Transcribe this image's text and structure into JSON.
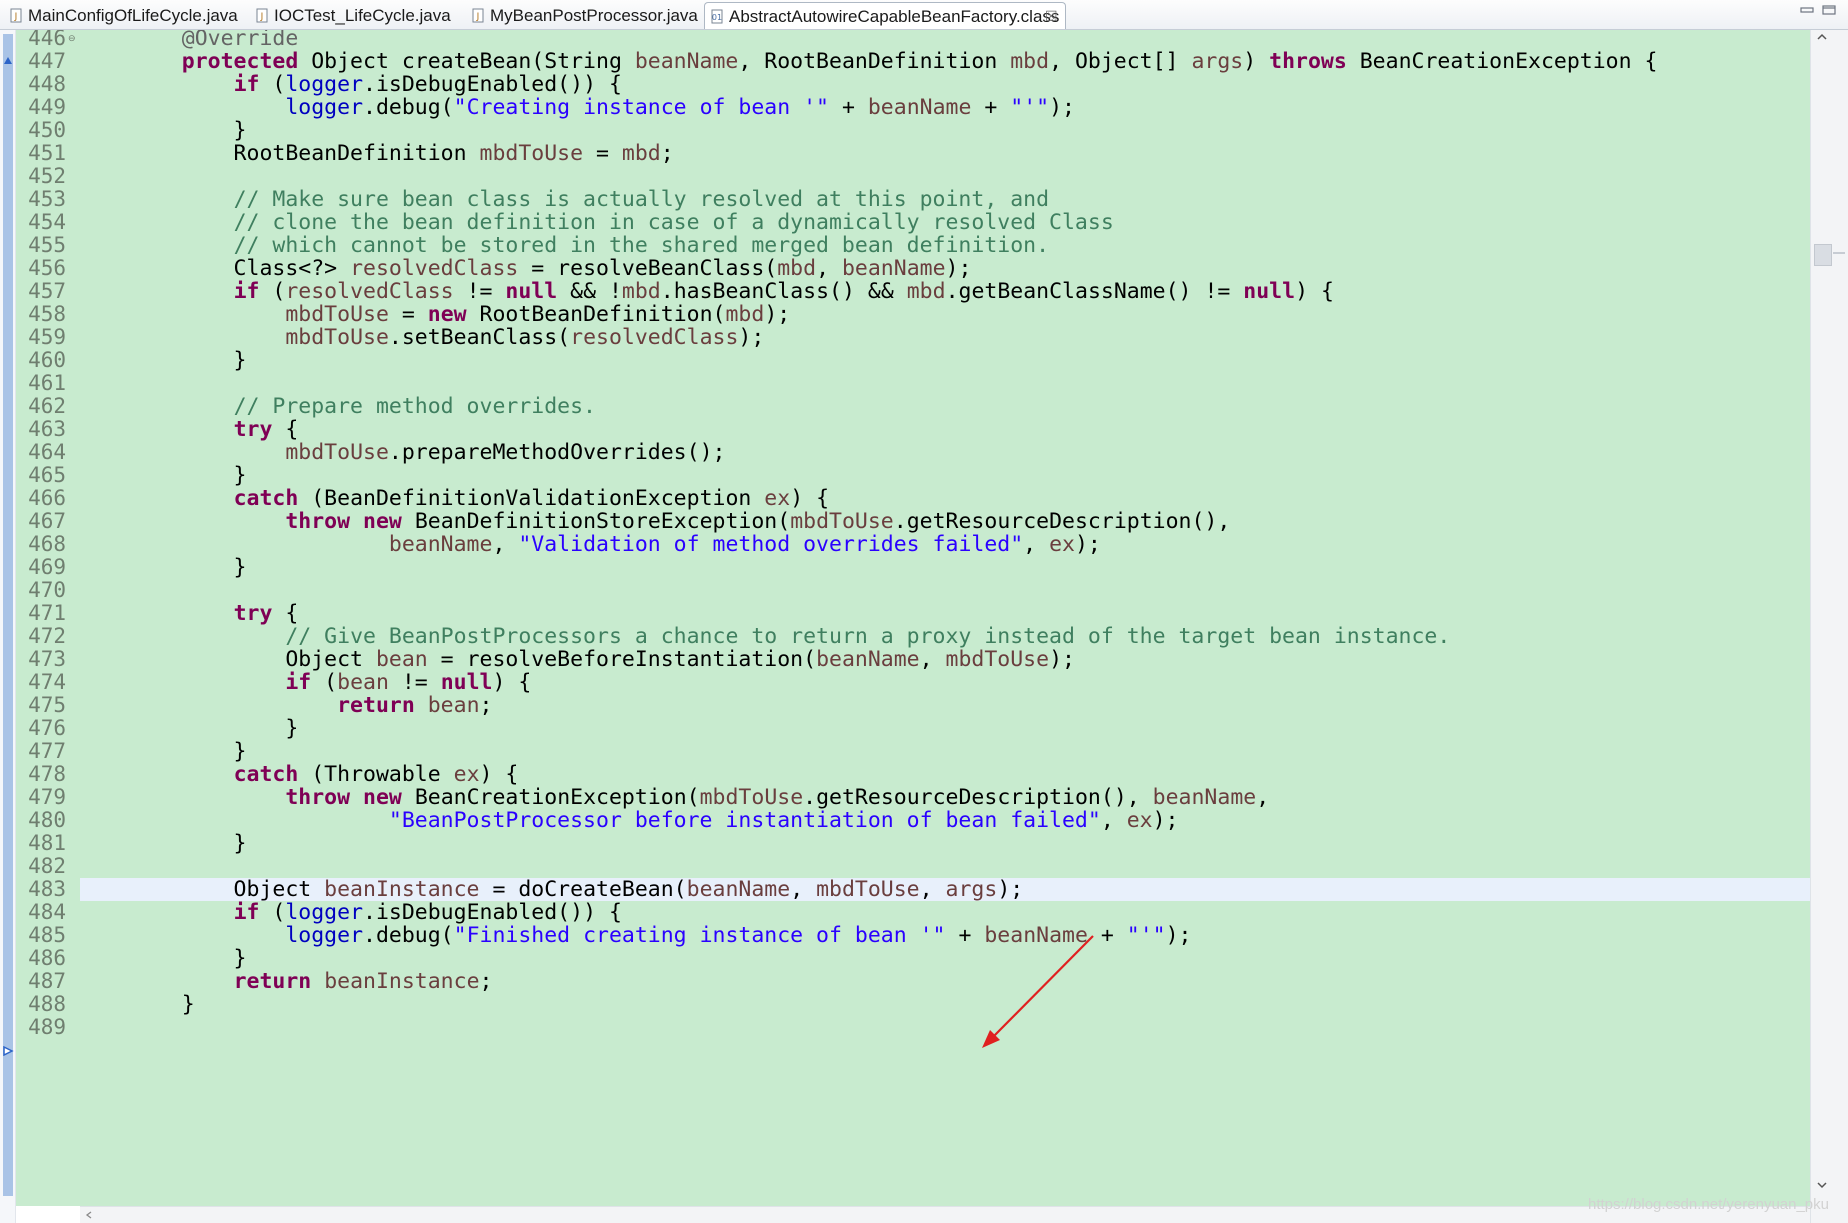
{
  "tabs": [
    {
      "label": "MainConfigOfLifeCycle.java",
      "icon": "java-file-icon",
      "active": false
    },
    {
      "label": "IOCTest_LifeCycle.java",
      "icon": "java-file-icon",
      "active": false
    },
    {
      "label": "MyBeanPostProcessor.java",
      "icon": "java-file-icon",
      "active": false
    },
    {
      "label": "AbstractAutowireCapableBeanFactory.class",
      "icon": "class-file-icon",
      "active": true
    }
  ],
  "tab_close_glyph": "☒",
  "editor": {
    "current_line": 483,
    "lines": [
      {
        "num": "446",
        "tokens": [
          [
            "    ",
            ""
          ],
          [
            "@Override",
            "ann"
          ]
        ]
      },
      {
        "num": "447",
        "tokens": [
          [
            "    ",
            ""
          ],
          [
            "protected",
            "kw"
          ],
          [
            " Object createBean(String ",
            ""
          ],
          [
            "beanName",
            "var"
          ],
          [
            ", RootBeanDefinition ",
            ""
          ],
          [
            "mbd",
            "var"
          ],
          [
            ", Object[] ",
            ""
          ],
          [
            "args",
            "var"
          ],
          [
            ") ",
            ""
          ],
          [
            "throws",
            "kw"
          ],
          [
            " BeanCreationException {",
            ""
          ]
        ]
      },
      {
        "num": "448",
        "tokens": [
          [
            "        ",
            ""
          ],
          [
            "if",
            "kw"
          ],
          [
            " (",
            ""
          ],
          [
            "logger",
            "fld"
          ],
          [
            ".isDebugEnabled()) {",
            ""
          ]
        ]
      },
      {
        "num": "449",
        "tokens": [
          [
            "            ",
            ""
          ],
          [
            "logger",
            "fld"
          ],
          [
            ".debug(",
            ""
          ],
          [
            "\"Creating instance of bean '\"",
            "str"
          ],
          [
            " + ",
            ""
          ],
          [
            "beanName",
            "var"
          ],
          [
            " + ",
            ""
          ],
          [
            "\"'\"",
            "str"
          ],
          [
            ");",
            ""
          ]
        ]
      },
      {
        "num": "450",
        "tokens": [
          [
            "        }",
            ""
          ]
        ]
      },
      {
        "num": "451",
        "tokens": [
          [
            "        RootBeanDefinition ",
            ""
          ],
          [
            "mbdToUse",
            "var"
          ],
          [
            " = ",
            ""
          ],
          [
            "mbd",
            "var"
          ],
          [
            ";",
            ""
          ]
        ]
      },
      {
        "num": "452",
        "tokens": []
      },
      {
        "num": "453",
        "tokens": [
          [
            "        ",
            ""
          ],
          [
            "// Make sure bean class is actually resolved at this point, and",
            "com"
          ]
        ]
      },
      {
        "num": "454",
        "tokens": [
          [
            "        ",
            ""
          ],
          [
            "// clone the bean definition in case of a dynamically resolved Class",
            "com"
          ]
        ]
      },
      {
        "num": "455",
        "tokens": [
          [
            "        ",
            ""
          ],
          [
            "// which cannot be stored in the shared merged bean definition.",
            "com"
          ]
        ]
      },
      {
        "num": "456",
        "tokens": [
          [
            "        Class<?> ",
            ""
          ],
          [
            "resolvedClass",
            "var"
          ],
          [
            " = resolveBeanClass(",
            ""
          ],
          [
            "mbd",
            "var"
          ],
          [
            ", ",
            ""
          ],
          [
            "beanName",
            "var"
          ],
          [
            ");",
            ""
          ]
        ]
      },
      {
        "num": "457",
        "tokens": [
          [
            "        ",
            ""
          ],
          [
            "if",
            "kw"
          ],
          [
            " (",
            ""
          ],
          [
            "resolvedClass",
            "var"
          ],
          [
            " != ",
            ""
          ],
          [
            "null",
            "kw"
          ],
          [
            " && !",
            ""
          ],
          [
            "mbd",
            "var"
          ],
          [
            ".hasBeanClass() && ",
            ""
          ],
          [
            "mbd",
            "var"
          ],
          [
            ".getBeanClassName() != ",
            ""
          ],
          [
            "null",
            "kw"
          ],
          [
            ") {",
            ""
          ]
        ]
      },
      {
        "num": "458",
        "tokens": [
          [
            "            ",
            ""
          ],
          [
            "mbdToUse",
            "var"
          ],
          [
            " = ",
            ""
          ],
          [
            "new",
            "kw"
          ],
          [
            " RootBeanDefinition(",
            ""
          ],
          [
            "mbd",
            "var"
          ],
          [
            ");",
            ""
          ]
        ]
      },
      {
        "num": "459",
        "tokens": [
          [
            "            ",
            ""
          ],
          [
            "mbdToUse",
            "var"
          ],
          [
            ".setBeanClass(",
            ""
          ],
          [
            "resolvedClass",
            "var"
          ],
          [
            ");",
            ""
          ]
        ]
      },
      {
        "num": "460",
        "tokens": [
          [
            "        }",
            ""
          ]
        ]
      },
      {
        "num": "461",
        "tokens": []
      },
      {
        "num": "462",
        "tokens": [
          [
            "        ",
            ""
          ],
          [
            "// Prepare method overrides.",
            "com"
          ]
        ]
      },
      {
        "num": "463",
        "tokens": [
          [
            "        ",
            ""
          ],
          [
            "try",
            "kw"
          ],
          [
            " {",
            ""
          ]
        ]
      },
      {
        "num": "464",
        "tokens": [
          [
            "            ",
            ""
          ],
          [
            "mbdToUse",
            "var"
          ],
          [
            ".prepareMethodOverrides();",
            ""
          ]
        ]
      },
      {
        "num": "465",
        "tokens": [
          [
            "        }",
            ""
          ]
        ]
      },
      {
        "num": "466",
        "tokens": [
          [
            "        ",
            ""
          ],
          [
            "catch",
            "kw"
          ],
          [
            " (BeanDefinitionValidationException ",
            ""
          ],
          [
            "ex",
            "var"
          ],
          [
            ") {",
            ""
          ]
        ]
      },
      {
        "num": "467",
        "tokens": [
          [
            "            ",
            ""
          ],
          [
            "throw",
            "kw"
          ],
          [
            " ",
            ""
          ],
          [
            "new",
            "kw"
          ],
          [
            " BeanDefinitionStoreException(",
            ""
          ],
          [
            "mbdToUse",
            "var"
          ],
          [
            ".getResourceDescription(),",
            ""
          ]
        ]
      },
      {
        "num": "468",
        "tokens": [
          [
            "                    ",
            ""
          ],
          [
            "beanName",
            "var"
          ],
          [
            ", ",
            ""
          ],
          [
            "\"Validation of method overrides failed\"",
            "str"
          ],
          [
            ", ",
            ""
          ],
          [
            "ex",
            "var"
          ],
          [
            ");",
            ""
          ]
        ]
      },
      {
        "num": "469",
        "tokens": [
          [
            "        }",
            ""
          ]
        ]
      },
      {
        "num": "470",
        "tokens": []
      },
      {
        "num": "471",
        "tokens": [
          [
            "        ",
            ""
          ],
          [
            "try",
            "kw"
          ],
          [
            " {",
            ""
          ]
        ]
      },
      {
        "num": "472",
        "tokens": [
          [
            "            ",
            ""
          ],
          [
            "// Give BeanPostProcessors a chance to return a proxy instead of the target bean instance.",
            "com"
          ]
        ]
      },
      {
        "num": "473",
        "tokens": [
          [
            "            Object ",
            ""
          ],
          [
            "bean",
            "var"
          ],
          [
            " = resolveBeforeInstantiation(",
            ""
          ],
          [
            "beanName",
            "var"
          ],
          [
            ", ",
            ""
          ],
          [
            "mbdToUse",
            "var"
          ],
          [
            ");",
            ""
          ]
        ]
      },
      {
        "num": "474",
        "tokens": [
          [
            "            ",
            ""
          ],
          [
            "if",
            "kw"
          ],
          [
            " (",
            ""
          ],
          [
            "bean",
            "var"
          ],
          [
            " != ",
            ""
          ],
          [
            "null",
            "kw"
          ],
          [
            ") {",
            ""
          ]
        ]
      },
      {
        "num": "475",
        "tokens": [
          [
            "                ",
            ""
          ],
          [
            "return",
            "kw"
          ],
          [
            " ",
            ""
          ],
          [
            "bean",
            "var"
          ],
          [
            ";",
            ""
          ]
        ]
      },
      {
        "num": "476",
        "tokens": [
          [
            "            }",
            ""
          ]
        ]
      },
      {
        "num": "477",
        "tokens": [
          [
            "        }",
            ""
          ]
        ]
      },
      {
        "num": "478",
        "tokens": [
          [
            "        ",
            ""
          ],
          [
            "catch",
            "kw"
          ],
          [
            " (Throwable ",
            ""
          ],
          [
            "ex",
            "var"
          ],
          [
            ") {",
            ""
          ]
        ]
      },
      {
        "num": "479",
        "tokens": [
          [
            "            ",
            ""
          ],
          [
            "throw",
            "kw"
          ],
          [
            " ",
            ""
          ],
          [
            "new",
            "kw"
          ],
          [
            " BeanCreationException(",
            ""
          ],
          [
            "mbdToUse",
            "var"
          ],
          [
            ".getResourceDescription(), ",
            ""
          ],
          [
            "beanName",
            "var"
          ],
          [
            ",",
            ""
          ]
        ]
      },
      {
        "num": "480",
        "tokens": [
          [
            "                    ",
            ""
          ],
          [
            "\"BeanPostProcessor before instantiation of bean failed\"",
            "str"
          ],
          [
            ", ",
            ""
          ],
          [
            "ex",
            "var"
          ],
          [
            ");",
            ""
          ]
        ]
      },
      {
        "num": "481",
        "tokens": [
          [
            "        }",
            ""
          ]
        ]
      },
      {
        "num": "482",
        "tokens": []
      },
      {
        "num": "483",
        "tokens": [
          [
            "        Object ",
            ""
          ],
          [
            "beanInstance",
            "var"
          ],
          [
            " = doCreateBean(",
            ""
          ],
          [
            "beanName",
            "var"
          ],
          [
            ", ",
            ""
          ],
          [
            "mbdToUse",
            "var"
          ],
          [
            ", ",
            ""
          ],
          [
            "args",
            "var"
          ],
          [
            ");",
            ""
          ]
        ]
      },
      {
        "num": "484",
        "tokens": [
          [
            "        ",
            ""
          ],
          [
            "if",
            "kw"
          ],
          [
            " (",
            ""
          ],
          [
            "logger",
            "fld"
          ],
          [
            ".isDebugEnabled()) {",
            ""
          ]
        ]
      },
      {
        "num": "485",
        "tokens": [
          [
            "            ",
            ""
          ],
          [
            "logger",
            "fld"
          ],
          [
            ".debug(",
            ""
          ],
          [
            "\"Finished creating instance of bean '\"",
            "str"
          ],
          [
            " + ",
            ""
          ],
          [
            "beanName",
            "var"
          ],
          [
            " + ",
            ""
          ],
          [
            "\"'\"",
            "str"
          ],
          [
            ");",
            ""
          ]
        ]
      },
      {
        "num": "486",
        "tokens": [
          [
            "        }",
            ""
          ]
        ]
      },
      {
        "num": "487",
        "tokens": [
          [
            "        ",
            ""
          ],
          [
            "return",
            "kw"
          ],
          [
            " ",
            ""
          ],
          [
            "beanInstance",
            "var"
          ],
          [
            ";",
            ""
          ]
        ]
      },
      {
        "num": "488",
        "tokens": [
          [
            "    }",
            ""
          ]
        ]
      },
      {
        "num": "489",
        "tokens": []
      }
    ]
  },
  "watermark": "https://blog.csdn.net/yerenyuan_pku",
  "colors": {
    "editor_bg": "#c8ebcf",
    "current_line": "#e8f0fb",
    "keyword": "#7f0055",
    "string": "#2a00ff",
    "comment": "#3f7f5f",
    "annotation": "#646464",
    "field": "#0000c0",
    "local_variable": "#6a3e3e",
    "annotation_arrow": "#e02020"
  }
}
